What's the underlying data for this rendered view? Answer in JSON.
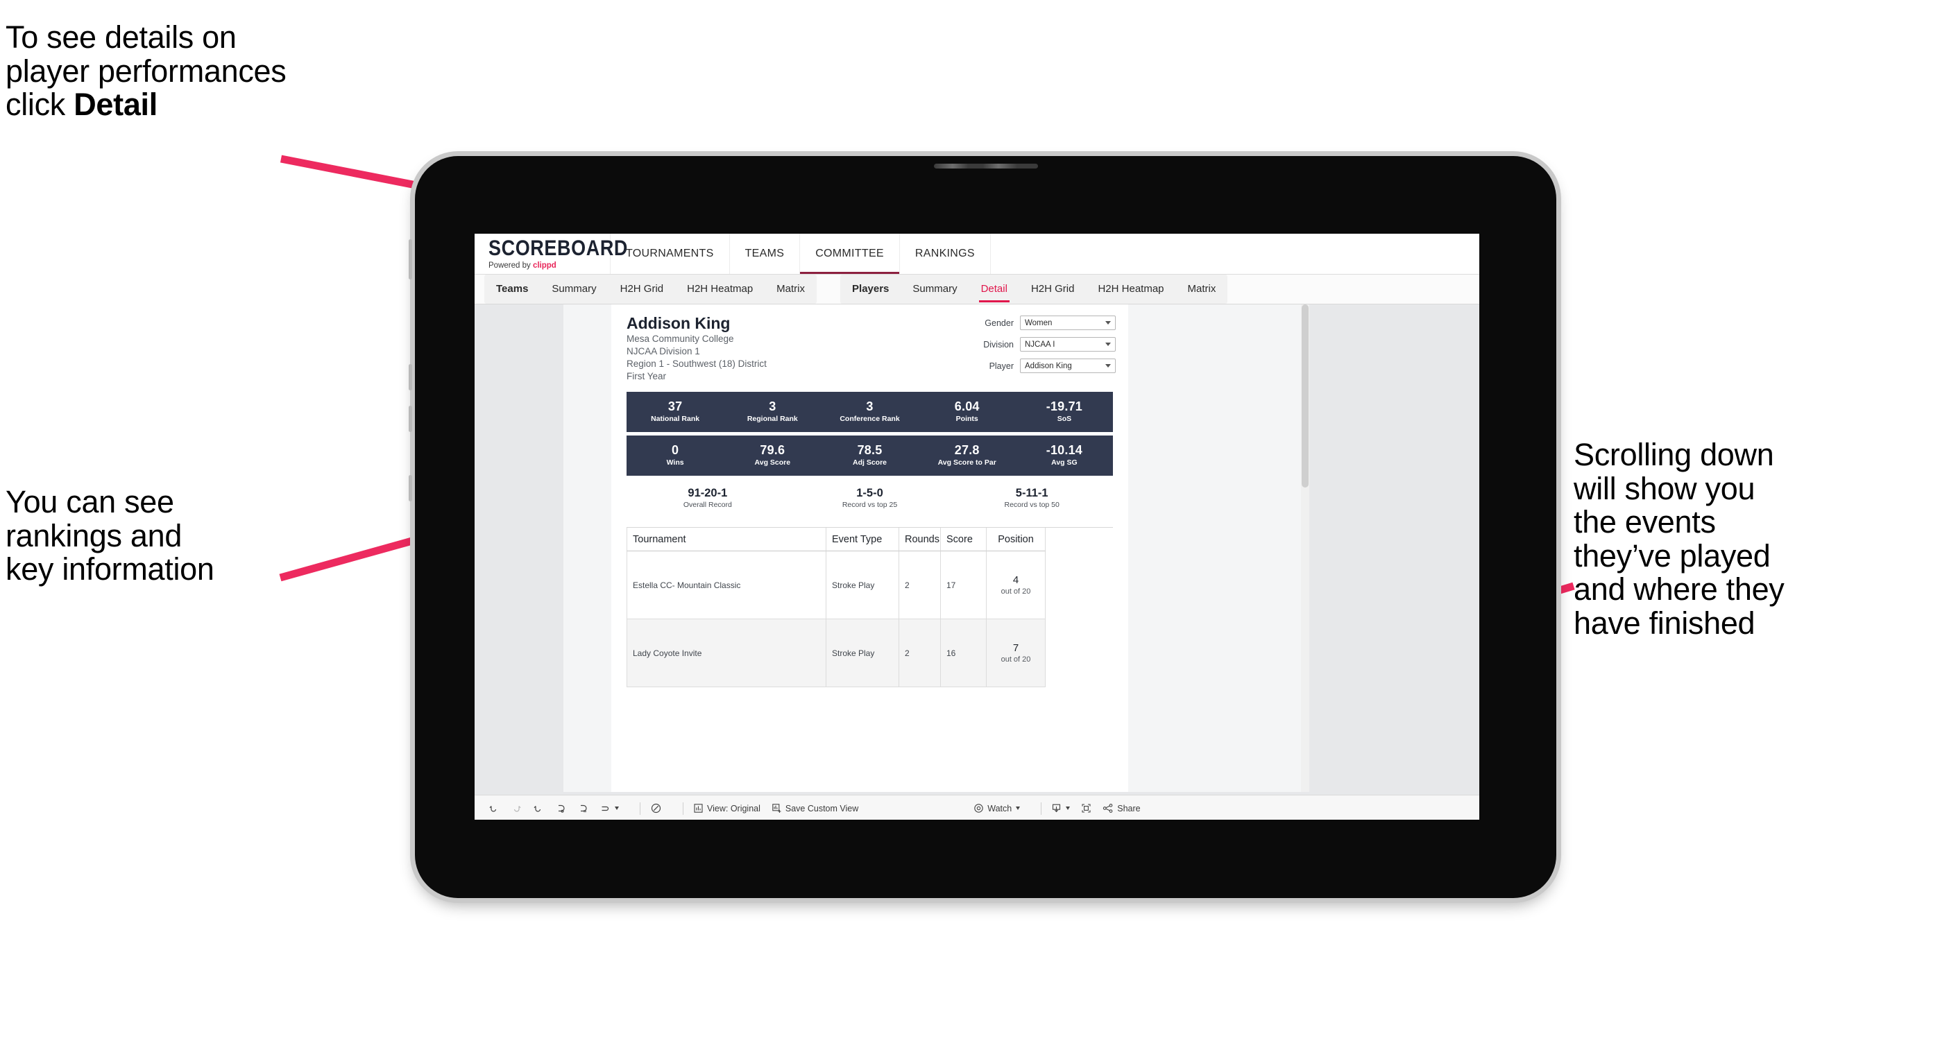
{
  "annotations": {
    "detail": {
      "line1": "To see details on",
      "line2": "player performances",
      "line3_pre": "click ",
      "line3_bold": "Detail"
    },
    "rankings": {
      "line1": "You can see",
      "line2": "rankings and",
      "line3": "key information"
    },
    "scroll": {
      "line1": "Scrolling down",
      "line2": "will show you",
      "line3": "the events",
      "line4": "they’ve played",
      "line5": "and where they",
      "line6": "have finished"
    }
  },
  "colors": {
    "accent_pink": "#ed2a5f",
    "navy": "#323a50",
    "brand_pink": "#e8265a",
    "tab_active": "#e0174c"
  },
  "app": {
    "brand": {
      "title": "SCOREBOARD",
      "powered_prefix": "Powered by ",
      "powered_name": "clippd"
    },
    "topnav": [
      {
        "label": "TOURNAMENTS",
        "active": false
      },
      {
        "label": "TEAMS",
        "active": false
      },
      {
        "label": "COMMITTEE",
        "active": true
      },
      {
        "label": "RANKINGS",
        "active": false
      }
    ],
    "subnav": {
      "group_teams": [
        {
          "label": "Teams",
          "bold": true,
          "selected": false
        },
        {
          "label": "Summary",
          "bold": false,
          "selected": false
        },
        {
          "label": "H2H Grid",
          "bold": false,
          "selected": false
        },
        {
          "label": "H2H Heatmap",
          "bold": false,
          "selected": false
        },
        {
          "label": "Matrix",
          "bold": false,
          "selected": false
        }
      ],
      "group_players": [
        {
          "label": "Players",
          "bold": true,
          "selected": false
        },
        {
          "label": "Summary",
          "bold": false,
          "selected": false
        },
        {
          "label": "Detail",
          "bold": false,
          "selected": true
        },
        {
          "label": "H2H Grid",
          "bold": false,
          "selected": false
        },
        {
          "label": "H2H Heatmap",
          "bold": false,
          "selected": false
        },
        {
          "label": "Matrix",
          "bold": false,
          "selected": false
        }
      ]
    },
    "player": {
      "name": "Addison King",
      "school": "Mesa Community College",
      "division": "NJCAA Division 1",
      "region": "Region 1 - Southwest (18) District",
      "year": "First Year"
    },
    "filters": [
      {
        "label": "Gender",
        "value": "Women"
      },
      {
        "label": "Division",
        "value": "NJCAA I"
      },
      {
        "label": "Player",
        "value": "Addison King"
      }
    ],
    "stats_band_1": [
      {
        "value": "37",
        "label": "National Rank"
      },
      {
        "value": "3",
        "label": "Regional Rank"
      },
      {
        "value": "3",
        "label": "Conference Rank"
      },
      {
        "value": "6.04",
        "label": "Points"
      },
      {
        "value": "-19.71",
        "label": "SoS"
      }
    ],
    "stats_band_2": [
      {
        "value": "0",
        "label": "Wins"
      },
      {
        "value": "79.6",
        "label": "Avg Score"
      },
      {
        "value": "78.5",
        "label": "Adj Score"
      },
      {
        "value": "27.8",
        "label": "Avg Score to Par"
      },
      {
        "value": "-10.14",
        "label": "Avg SG"
      }
    ],
    "records": [
      {
        "value": "91-20-1",
        "label": "Overall Record"
      },
      {
        "value": "1-5-0",
        "label": "Record vs top 25"
      },
      {
        "value": "5-11-1",
        "label": "Record vs top 50"
      }
    ],
    "events_table": {
      "columns": [
        "Tournament",
        "Event Type",
        "Rounds",
        "Score",
        "Position"
      ],
      "rows": [
        {
          "tournament": "Estella CC- Mountain Classic",
          "event_type": "Stroke Play",
          "rounds": "2",
          "score": "17",
          "position_value": "4",
          "position_label": "out of 20"
        },
        {
          "tournament": "Lady Coyote Invite",
          "event_type": "Stroke Play",
          "rounds": "2",
          "score": "16",
          "position_value": "7",
          "position_label": "out of 20"
        }
      ]
    },
    "toolbar": {
      "view_label": "View: Original",
      "save_label": "Save Custom View",
      "watch_label": "Watch",
      "share_label": "Share"
    }
  }
}
